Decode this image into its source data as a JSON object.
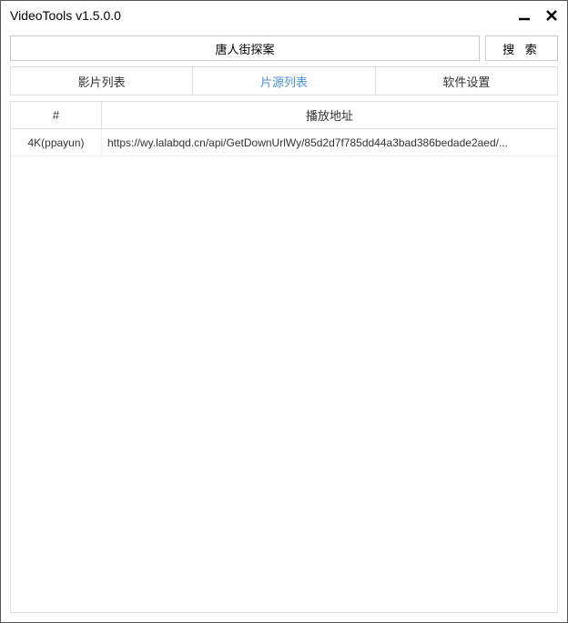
{
  "window": {
    "title": "VideoTools v1.5.0.0"
  },
  "search": {
    "value": "唐人街探案",
    "button_label": "搜 索"
  },
  "tabs": {
    "items": [
      {
        "label": "影片列表",
        "active": false
      },
      {
        "label": "片源列表",
        "active": true
      },
      {
        "label": "软件设置",
        "active": false
      }
    ]
  },
  "table": {
    "headers": {
      "num": "#",
      "url": "播放地址"
    },
    "rows": [
      {
        "num": "4K(ppayun)",
        "url": "https://wy.lalabqd.cn/api/GetDownUrlWy/85d2d7f785dd44a3bad386bedade2aed/..."
      }
    ]
  }
}
